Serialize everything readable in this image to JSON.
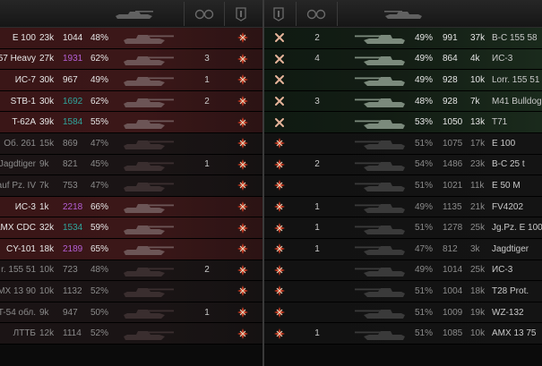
{
  "header": {
    "left_icons": [
      "tank-icon",
      "platoon-icon",
      "squad-flag-icon"
    ],
    "right_icons": [
      "squad-flag-icon",
      "platoon-icon",
      "tank-icon"
    ]
  },
  "colors": {
    "enemy_alive_bg": "#3b1718",
    "ally_alive_bg": "#131d14",
    "rating_purple": "#b45fd6",
    "rating_teal": "#2fa59d"
  },
  "left_team": [
    {
      "name": "E 100",
      "battles": "23k",
      "rating": "1044",
      "winrate": "48%",
      "rating_color": "normal",
      "platoon": "",
      "alive": true,
      "status": "destroyed"
    },
    {
      "name": "57 Heavy",
      "battles": "27k",
      "rating": "1931",
      "winrate": "62%",
      "rating_color": "purple",
      "platoon": "3",
      "alive": true,
      "status": "destroyed"
    },
    {
      "name": "ИС-7",
      "battles": "30k",
      "rating": "967",
      "winrate": "49%",
      "rating_color": "normal",
      "platoon": "1",
      "alive": true,
      "status": "destroyed"
    },
    {
      "name": "STB-1",
      "battles": "30k",
      "rating": "1692",
      "winrate": "62%",
      "rating_color": "teal",
      "platoon": "2",
      "alive": true,
      "status": "destroyed"
    },
    {
      "name": "T-62A",
      "battles": "39k",
      "rating": "1584",
      "winrate": "55%",
      "rating_color": "teal",
      "platoon": "",
      "alive": true,
      "status": "destroyed"
    },
    {
      "name": "Об. 261",
      "battles": "15k",
      "rating": "869",
      "winrate": "47%",
      "rating_color": "normal",
      "platoon": "",
      "alive": false,
      "status": "destroyed"
    },
    {
      "name": "Jagdtiger",
      "battles": "9k",
      "rating": "821",
      "winrate": "45%",
      "rating_color": "normal",
      "platoon": "1",
      "alive": false,
      "status": "destroyed"
    },
    {
      "name": "auf Pz. IV",
      "battles": "7k",
      "rating": "753",
      "winrate": "47%",
      "rating_color": "normal",
      "platoon": "",
      "alive": false,
      "status": "destroyed"
    },
    {
      "name": "ИС-3",
      "battles": "1k",
      "rating": "2218",
      "winrate": "66%",
      "rating_color": "purple",
      "platoon": "",
      "alive": true,
      "status": "destroyed"
    },
    {
      "name": "AMX CDC",
      "battles": "32k",
      "rating": "1534",
      "winrate": "59%",
      "rating_color": "teal",
      "platoon": "",
      "alive": true,
      "status": "destroyed"
    },
    {
      "name": "CY-101",
      "battles": "18k",
      "rating": "2189",
      "winrate": "65%",
      "rating_color": "purple",
      "platoon": "",
      "alive": true,
      "status": "destroyed"
    },
    {
      "name": "r. 155 51",
      "battles": "10k",
      "rating": "723",
      "winrate": "48%",
      "rating_color": "normal",
      "platoon": "2",
      "alive": false,
      "status": "destroyed"
    },
    {
      "name": "MX 13 90",
      "battles": "10k",
      "rating": "1132",
      "winrate": "52%",
      "rating_color": "normal",
      "platoon": "",
      "alive": false,
      "status": "destroyed"
    },
    {
      "name": "T-54 обл.",
      "battles": "9k",
      "rating": "947",
      "winrate": "50%",
      "rating_color": "normal",
      "platoon": "1",
      "alive": false,
      "status": "destroyed"
    },
    {
      "name": "ЛТТБ",
      "battles": "12k",
      "rating": "1114",
      "winrate": "52%",
      "rating_color": "normal",
      "platoon": "",
      "alive": false,
      "status": "destroyed"
    }
  ],
  "right_team": [
    {
      "name": "B-C 155 58",
      "battles": "37k",
      "rating": "991",
      "winrate": "49%",
      "platoon": "2",
      "alive": true,
      "status": "crossed"
    },
    {
      "name": "ИС-3",
      "battles": "4k",
      "rating": "864",
      "winrate": "49%",
      "platoon": "4",
      "alive": true,
      "status": "crossed"
    },
    {
      "name": "Lorr. 155 51",
      "battles": "10k",
      "rating": "928",
      "winrate": "49%",
      "platoon": "",
      "alive": true,
      "status": "crossed"
    },
    {
      "name": "M41 Bulldog",
      "battles": "7k",
      "rating": "928",
      "winrate": "48%",
      "platoon": "3",
      "alive": true,
      "status": "crossed"
    },
    {
      "name": "T71",
      "battles": "13k",
      "rating": "1050",
      "winrate": "53%",
      "platoon": "",
      "alive": true,
      "status": "crossed"
    },
    {
      "name": "E 100",
      "battles": "17k",
      "rating": "1075",
      "winrate": "51%",
      "platoon": "",
      "alive": false,
      "status": "destroyed"
    },
    {
      "name": "B-C 25 t",
      "battles": "23k",
      "rating": "1486",
      "winrate": "54%",
      "platoon": "2",
      "alive": false,
      "status": "destroyed"
    },
    {
      "name": "E 50 M",
      "battles": "11k",
      "rating": "1021",
      "winrate": "51%",
      "platoon": "",
      "alive": false,
      "status": "destroyed"
    },
    {
      "name": "FV4202",
      "battles": "21k",
      "rating": "1135",
      "winrate": "49%",
      "platoon": "1",
      "alive": false,
      "status": "destroyed"
    },
    {
      "name": "Jg.Pz. E 100",
      "battles": "25k",
      "rating": "1278",
      "winrate": "51%",
      "platoon": "1",
      "alive": false,
      "status": "destroyed"
    },
    {
      "name": "Jagdtiger",
      "battles": "3k",
      "rating": "812",
      "winrate": "47%",
      "platoon": "1",
      "alive": false,
      "status": "destroyed"
    },
    {
      "name": "ИС-3",
      "battles": "25k",
      "rating": "1014",
      "winrate": "49%",
      "platoon": "",
      "alive": false,
      "status": "destroyed"
    },
    {
      "name": "T28 Prot.",
      "battles": "18k",
      "rating": "1004",
      "winrate": "51%",
      "platoon": "",
      "alive": false,
      "status": "destroyed"
    },
    {
      "name": "WZ-132",
      "battles": "19k",
      "rating": "1009",
      "winrate": "51%",
      "platoon": "",
      "alive": false,
      "status": "destroyed"
    },
    {
      "name": "AMX 13 75",
      "battles": "10k",
      "rating": "1085",
      "winrate": "51%",
      "platoon": "1",
      "alive": false,
      "status": "destroyed"
    }
  ]
}
